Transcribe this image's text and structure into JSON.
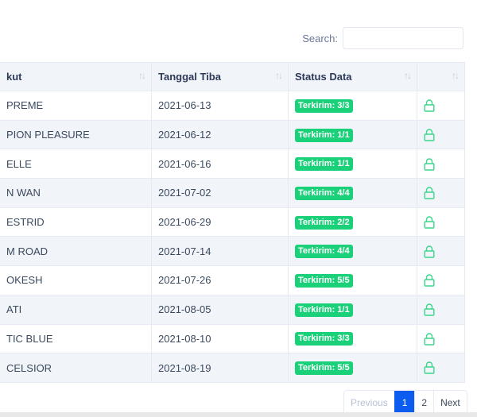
{
  "search": {
    "label": "Search:",
    "value": "",
    "placeholder": ""
  },
  "table": {
    "columns": [
      {
        "label": "kut"
      },
      {
        "label": "Tanggal Tiba"
      },
      {
        "label": "Status Data"
      },
      {
        "label": ""
      }
    ],
    "sort_glyph": "↑↓",
    "rows": [
      {
        "name": "PREME",
        "date": "2021-06-13",
        "status": "Terkirim: 3/3",
        "icon": "lock-icon"
      },
      {
        "name": "PION PLEASURE",
        "date": "2021-06-12",
        "status": "Terkirim: 1/1",
        "icon": "lock-icon"
      },
      {
        "name": "ELLE",
        "date": "2021-06-16",
        "status": "Terkirim: 1/1",
        "icon": "lock-icon"
      },
      {
        "name": "N WAN",
        "date": "2021-07-02",
        "status": "Terkirim: 4/4",
        "icon": "lock-icon"
      },
      {
        "name": "ESTRID",
        "date": "2021-06-29",
        "status": "Terkirim: 2/2",
        "icon": "lock-icon"
      },
      {
        "name": "M ROAD",
        "date": "2021-07-14",
        "status": "Terkirim: 4/4",
        "icon": "lock-icon"
      },
      {
        "name": "OKESH",
        "date": "2021-07-26",
        "status": "Terkirim: 5/5",
        "icon": "lock-icon"
      },
      {
        "name": "ATI",
        "date": "2021-08-05",
        "status": "Terkirim: 1/1",
        "icon": "lock-icon"
      },
      {
        "name": "TIC BLUE",
        "date": "2021-08-10",
        "status": "Terkirim: 3/3",
        "icon": "lock-icon"
      },
      {
        "name": "CELSIOR",
        "date": "2021-08-19",
        "status": "Terkirim: 5/5",
        "icon": "lock-icon"
      }
    ]
  },
  "pagination": {
    "previous_label": "Previous",
    "pages": [
      "1",
      "2"
    ],
    "current_page": "1",
    "next_label": "Next"
  },
  "colors": {
    "badge_green": "#1ad179",
    "lock_green": "#3dd68c",
    "active_page_blue": "#0d5cf0",
    "header_bg": "#f1f4f9"
  }
}
